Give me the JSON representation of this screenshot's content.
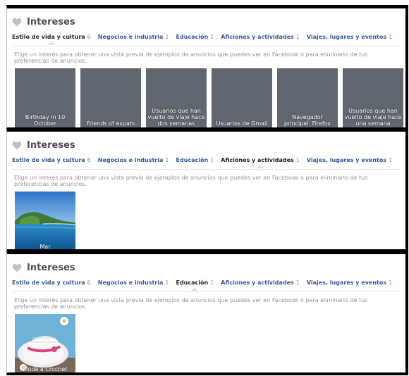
{
  "panels": [
    {
      "title": "Intereses",
      "description": "Elige un interés para obtener una vista previa de ejemplos de anuncios que puedes ver en Facebook o para eliminarlo de tus preferencias de anuncios.",
      "tabs": [
        {
          "label": "Estilo de vida y cultura",
          "count": "6",
          "active": true
        },
        {
          "label": "Negocios e industria",
          "count": "1",
          "active": false
        },
        {
          "label": "Educación",
          "count": "1",
          "active": false
        },
        {
          "label": "Aficiones y actividades",
          "count": "1",
          "active": false
        },
        {
          "label": "Viajes, lugares y eventos",
          "count": "1",
          "active": false
        }
      ],
      "tiles": [
        {
          "label": "Birthday in 10 October",
          "image": "gray"
        },
        {
          "label": "Friends of expats",
          "image": "gray"
        },
        {
          "label": "Usuarios que han vuelto de viaje hace dos semanas",
          "image": "gray"
        },
        {
          "label": "Usuarios de Gmail",
          "image": "gray"
        },
        {
          "label": "Navegador principal: Firefox",
          "image": "gray"
        },
        {
          "label": "Usuarios que han vuelto de viaje hace una semana",
          "image": "gray"
        }
      ]
    },
    {
      "title": "Intereses",
      "description": "Elige un interés para obtener una vista previa de ejemplos de anuncios que puedes ver en Facebook o para eliminarlo de tus preferencias de anuncios.",
      "tabs": [
        {
          "label": "Estilo de vida y cultura",
          "count": "6",
          "active": false
        },
        {
          "label": "Negocios e industria",
          "count": "1",
          "active": false
        },
        {
          "label": "Educación",
          "count": "1",
          "active": false
        },
        {
          "label": "Aficiones y actividades",
          "count": "1",
          "active": true
        },
        {
          "label": "Viajes, lugares y eventos",
          "count": "1",
          "active": false
        }
      ],
      "tiles": [
        {
          "label": "Mar",
          "image": "sea-photo"
        }
      ]
    },
    {
      "title": "Intereses",
      "description": "Elige un interés para obtener una vista previa de ejemplos de anuncios que puedes ver en Facebook o para eliminarlo de tus preferencias de anuncios.",
      "tabs": [
        {
          "label": "Estilo de vida y cultura",
          "count": "6",
          "active": false
        },
        {
          "label": "Negocios e industria",
          "count": "1",
          "active": false
        },
        {
          "label": "Educación",
          "count": "1",
          "active": true
        },
        {
          "label": "Aficiones y actividades",
          "count": "1",
          "active": false
        },
        {
          "label": "Viajes, lugares y eventos",
          "count": "1",
          "active": false
        }
      ],
      "tiles": [
        {
          "label": "Moda a Crochet",
          "image": "crochet-hat-photo"
        }
      ]
    }
  ],
  "colors": {
    "heart": "#bec3c9",
    "tab_link": "#365899",
    "tile_gray": "#606770"
  }
}
